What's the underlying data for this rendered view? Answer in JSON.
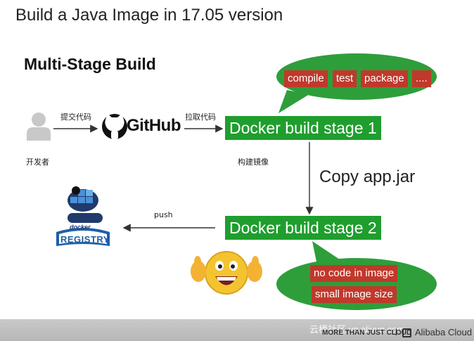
{
  "slide": {
    "title": "Build a Java Image in 17.05 version",
    "section_title": "Multi-Stage Build"
  },
  "developer": {
    "label": "开发者",
    "icon": "person-icon"
  },
  "edges": {
    "submit_code": "提交代码",
    "pull_code": "拉取代码",
    "build_image": "构建镜像",
    "copy": "Copy app.jar",
    "push": "push"
  },
  "github": {
    "text": "GitHub",
    "icon": "github-octocat-icon"
  },
  "stages": {
    "stage1": "Docker build stage 1",
    "stage2": "Docker build stage 2"
  },
  "bubble_top": {
    "tags": [
      "compile",
      "test",
      "package",
      "...."
    ]
  },
  "bubble_bottom": {
    "tags": [
      "no code in image",
      "small image size"
    ]
  },
  "registry": {
    "label": "REGISTRY",
    "sublabel": "docker",
    "icon": "docker-registry-icon"
  },
  "emoji": {
    "icon": "thumbs-up-grin-emoji-icon"
  },
  "footer": {
    "tagline": "MORE THAN JUST CLOUD",
    "separator": "|",
    "brand": "Alibaba Cloud",
    "watermark": "云栖社区 yq.aliyun.com"
  },
  "colors": {
    "stage_green": "#1f9e2e",
    "bubble_green": "#2e9e3b",
    "tag_red": "#c0392b",
    "registry_blue": "#1f5fa8"
  }
}
